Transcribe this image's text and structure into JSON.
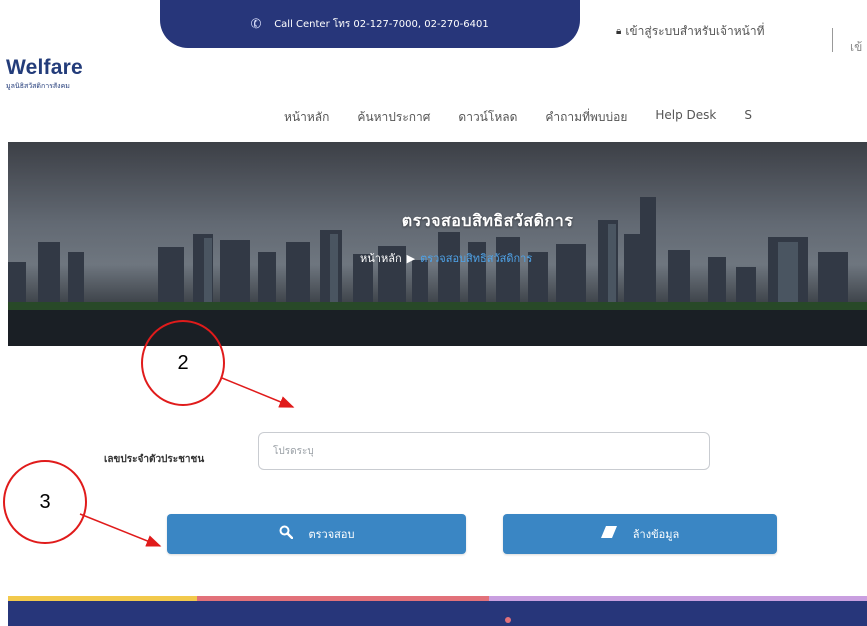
{
  "topbar": {
    "call_center": "Call Center โทร 02-127-7000, 02-270-6401",
    "staff_login": "เข้าสู่ระบบสำหรับเจ้าหน้าที่",
    "more": "เข้"
  },
  "logo": {
    "title": "Welfare",
    "subtitle": "มูลนิธิสวัสดิการสังคม"
  },
  "nav": {
    "items": [
      "หน้าหลัก",
      "ค้นหาประกาศ",
      "ดาวน์โหลด",
      "คำถามที่พบบ่อย",
      "Help Desk",
      "S"
    ]
  },
  "hero": {
    "title": "ตรวจสอบสิทธิสวัสดิการ",
    "breadcrumb_home": "หน้าหลัก",
    "breadcrumb_sep": "▶",
    "breadcrumb_current": "ตรวจสอบสิทธิสวัสดิการ"
  },
  "form": {
    "id_label": "เลขประจำตัวประชาชน",
    "id_value": "",
    "id_placeholder": "โปรดระบุ",
    "check_label": "ตรวจสอบ",
    "clear_label": "ล้างข้อมูล"
  },
  "annotations": {
    "step2": "2",
    "step3": "3"
  },
  "colors": {
    "navy": "#27367a",
    "button": "#3a86c4",
    "annotation": "#e01b1b",
    "breadcrumb_link": "#4fa3e8"
  },
  "icons": {
    "phone": "phone-icon",
    "lock": "lock-icon",
    "search": "search-icon",
    "eraser": "eraser-icon"
  }
}
